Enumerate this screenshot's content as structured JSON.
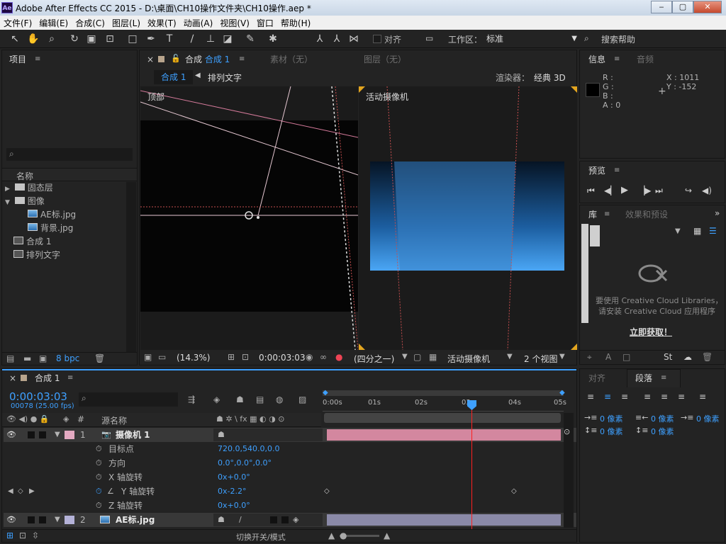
{
  "window": {
    "app_icon": "Ae",
    "title": "Adobe After Effects CC 2015 - D:\\桌面\\CH10操作文件夹\\CH10操作.aep *",
    "minimize": "‒",
    "restore": "▢",
    "close": "✕"
  },
  "menu": [
    "文件(F)",
    "编辑(E)",
    "合成(C)",
    "图层(L)",
    "效果(T)",
    "动画(A)",
    "视图(V)",
    "窗口",
    "帮助(H)"
  ],
  "toolbar": {
    "align_label": "对齐",
    "workspace_label": "工作区：",
    "workspace_value": "标准",
    "search_help": "搜索帮助"
  },
  "project": {
    "title": "项目",
    "column_name": "名称",
    "items": [
      {
        "name": "固态层",
        "type": "folder",
        "expanded": false
      },
      {
        "name": "图像",
        "type": "folder",
        "expanded": true
      },
      {
        "name": "AE标.jpg",
        "type": "image",
        "indent": 1
      },
      {
        "name": "背景.jpg",
        "type": "image",
        "indent": 1
      },
      {
        "name": "合成 1",
        "type": "comp"
      },
      {
        "name": "排列文字",
        "type": "comp"
      }
    ],
    "bpc": "8 bpc"
  },
  "comp_viewer": {
    "tab_prefix": "合成",
    "tab_name": "合成 1",
    "footage_tab": "素材（无）",
    "layer_tab": "图层（无）",
    "breadcrumb_active": "合成 1",
    "breadcrumb_next": "排列文字",
    "renderer_label": "渲染器：",
    "renderer_value": "经典 3D",
    "left_view_label": "顶部",
    "right_view_label": "活动摄像机",
    "zoom": "(14.3%)",
    "timecode": "0:00:03:03",
    "resolution": "(四分之一)",
    "camera_select": "活动摄像机",
    "views_select": "2 个视图"
  },
  "info": {
    "tab": "信息",
    "audio_tab": "音频",
    "r": "R :",
    "g": "G :",
    "b": "B :",
    "a": "A : 0",
    "x": "X : 1011",
    "y": "Y : -152"
  },
  "preview": {
    "tab": "预览"
  },
  "library": {
    "tab": "库",
    "effects_tab": "效果和预设",
    "message_line1": "要使用 Creative Cloud Libraries，",
    "message_line2": "请安装 Creative Cloud 应用程序",
    "get_now": "立即获取！"
  },
  "timeline": {
    "tab": "合成 1",
    "timecode": "0:00:03:03",
    "frames": "00078 (25.00 fps)",
    "column_name": "源名称",
    "column_num": "#",
    "ruler": [
      "0:00s",
      "01s",
      "02s",
      "03s",
      "04s",
      "05s"
    ],
    "layers": [
      {
        "num": "1",
        "name": "摄像机 1",
        "type": "camera",
        "label_color": "#e3a9c1"
      },
      {
        "prop": "目标点",
        "value": "720.0,540.0,0.0"
      },
      {
        "prop": "方向",
        "value": "0.0°,0.0°,0.0°"
      },
      {
        "prop": "X 轴旋转",
        "value": "0x+0.0°"
      },
      {
        "prop": "Y 轴旋转",
        "value": "0x-2.2°",
        "keyed": true
      },
      {
        "prop": "Z 轴旋转",
        "value": "0x+0.0°"
      },
      {
        "num": "2",
        "name": "AE标.jpg",
        "type": "image",
        "label_color": "#b4b2d8"
      }
    ],
    "switch_mode": "切换开关/模式"
  },
  "align_panel": {
    "align_tab": "对齐",
    "paragraph_tab": "段落",
    "px1": "0 像素",
    "px2": "0 像素",
    "px3": "0 像素",
    "px4": "0 像素",
    "px5": "0 像素"
  },
  "colors": {
    "accent_blue": "#3ea0ff",
    "playhead": "#ff2020",
    "camera_bar": "#d3879f",
    "image_bar": "#8a89a7"
  }
}
